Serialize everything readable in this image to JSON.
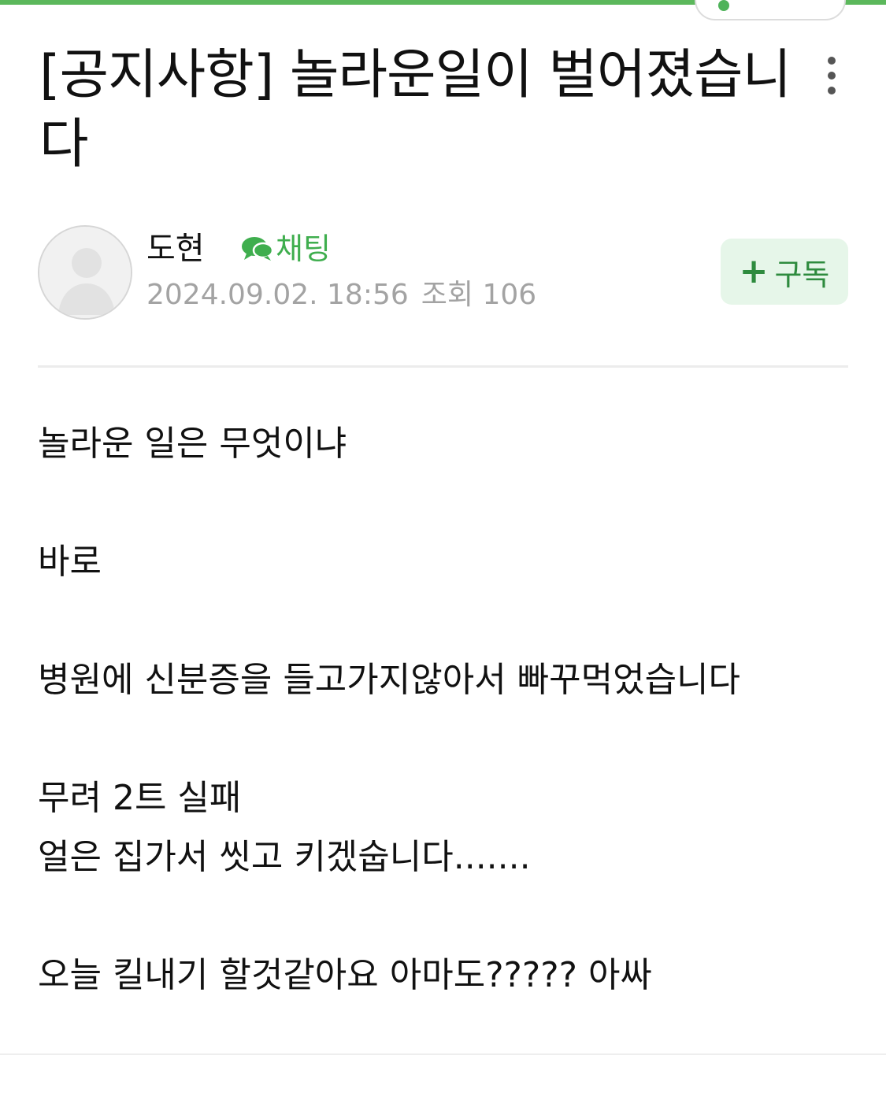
{
  "header": {
    "title": "[공지사항] 놀라운일이 벌어졌습니다",
    "more_icon": "more-vertical-icon",
    "accent_color": "#5cb85c"
  },
  "author": {
    "name": "도현",
    "chat_label": "채팅",
    "chat_icon": "chat-bubbles-icon",
    "date": "2024.09.02. 18:56",
    "views": "조회 106",
    "subscribe_label": "구독",
    "subscribe_icon": "plus-icon"
  },
  "content": {
    "lines": [
      "놀라운 일은 무엇이냐",
      "바로",
      "병원에 신분증을 들고가지않아서 빠꾸먹었습니다",
      "무려 2트 실패",
      "얼은 집가서 씻고 키겠숩니다.......",
      "오늘 킬내기 할것같아요 아마도????? 아싸"
    ]
  }
}
